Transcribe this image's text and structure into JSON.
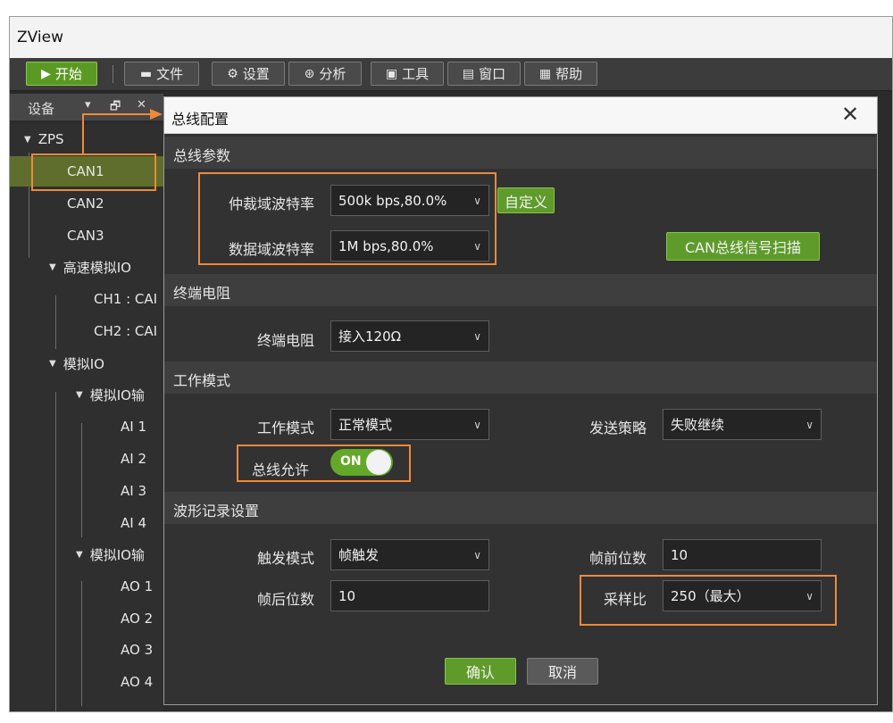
{
  "window": {
    "title": "ZView"
  },
  "toolbar": {
    "start": "开始",
    "file": "文件",
    "settings": "设置",
    "analysis": "分析",
    "tools": "工具",
    "window": "窗口",
    "help": "帮助"
  },
  "device_panel": {
    "title": "设备",
    "controls": [
      "▾",
      "🗗",
      "✕"
    ]
  },
  "tree": {
    "root": "ZPS",
    "can1": "CAN1",
    "can2": "CAN2",
    "can3": "CAN3",
    "hs_io": "高速模拟IO",
    "ch1": "CH1 : CAI",
    "ch2": "CH2 : CAI",
    "analog_io": "模拟IO",
    "ai_group": "模拟IO输",
    "ai1": "AI 1",
    "ai2": "AI 2",
    "ai3": "AI 3",
    "ai4": "AI 4",
    "ao_group": "模拟IO输",
    "ao1": "AO 1",
    "ao2": "AO 2",
    "ao3": "AO 3",
    "ao4": "AO 4"
  },
  "dialog": {
    "title": "总线配置",
    "close": "✕",
    "bus_params": {
      "section": "总线参数",
      "arb_label": "仲裁域波特率",
      "arb_value": "500k bps,80.0%",
      "custom_btn": "自定义",
      "data_label": "数据域波特率",
      "data_value": "1M bps,80.0%",
      "scan_btn": "CAN总线信号扫描"
    },
    "termination": {
      "section": "终端电阻",
      "label": "终端电阻",
      "value": "接入120Ω"
    },
    "work_mode": {
      "section": "工作模式",
      "mode_label": "工作模式",
      "mode_value": "正常模式",
      "policy_label": "发送策略",
      "policy_value": "失败继续",
      "bus_enable_label": "总线允许",
      "bus_enable_state": "ON"
    },
    "waveform": {
      "section": "波形记录设置",
      "trigger_label": "触发模式",
      "trigger_value": "帧触发",
      "pre_label": "帧前位数",
      "pre_value": "10",
      "post_label": "帧后位数",
      "post_value": "10",
      "rate_label": "采样比",
      "rate_value": "250（最大）"
    },
    "ok": "确认",
    "cancel": "取消"
  },
  "colors": {
    "accent_green": "#5f9b2a",
    "highlight": "#ef8a3a",
    "selection": "#5f6e2c"
  }
}
